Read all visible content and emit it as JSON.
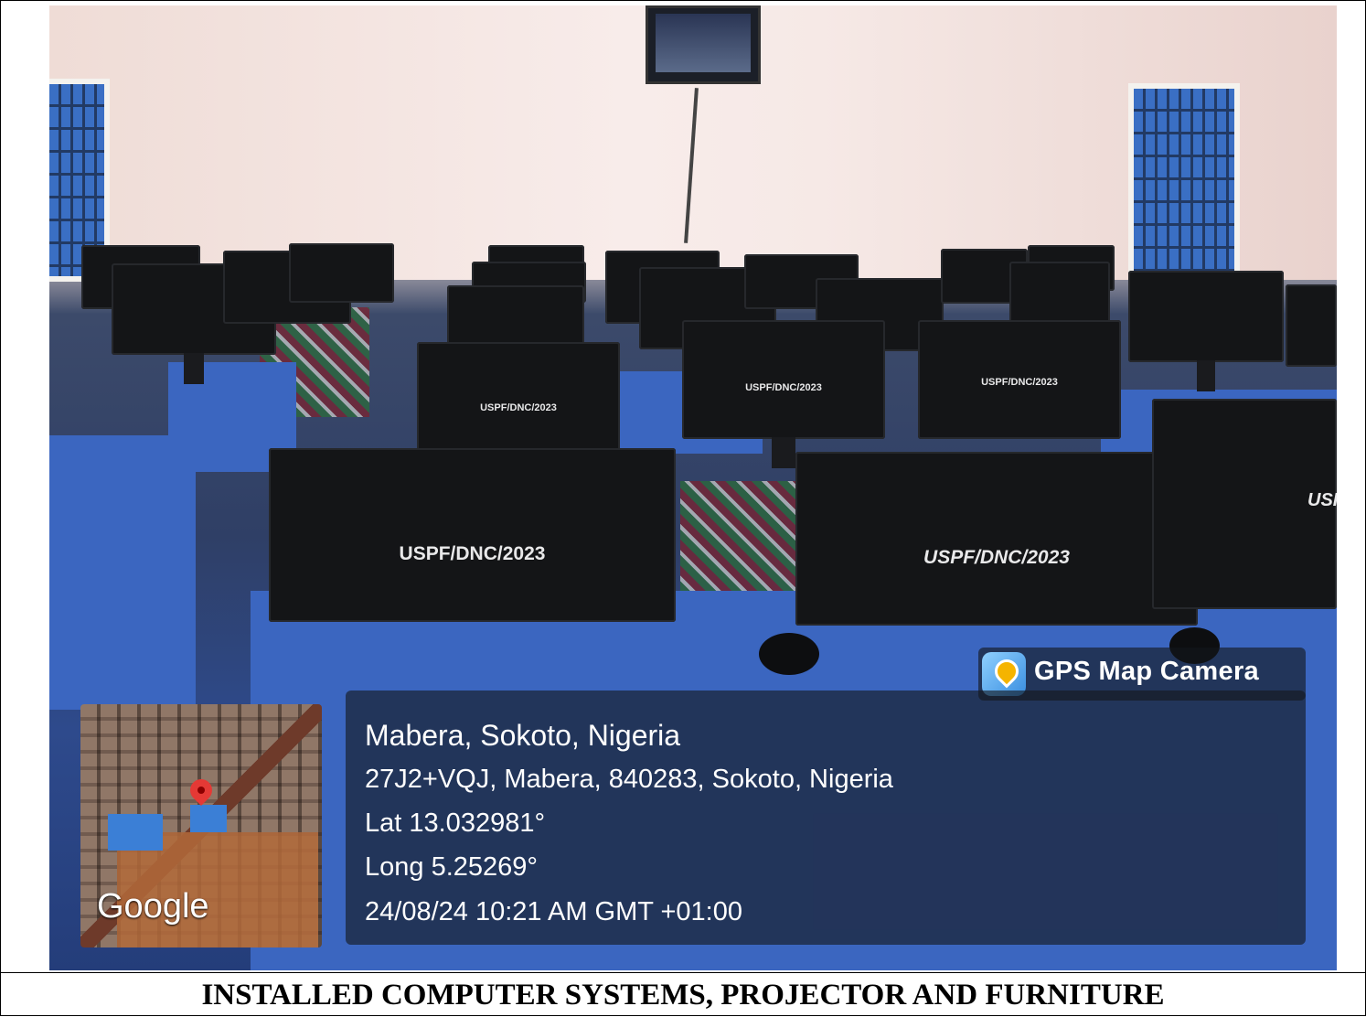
{
  "photo": {
    "monitor_labels": [
      "USPF/DNC/2023",
      "USPF/DNC/2023",
      "USPF/DNC/2023",
      "USPF/DNC/2023",
      "USPF/DNC/2023"
    ],
    "partial_label": "USPF"
  },
  "gps_overlay": {
    "app_name": "GPS Map Camera",
    "location_title": "Mabera, Sokoto, Nigeria",
    "address": "27J2+VQJ, Mabera, 840283, Sokoto, Nigeria",
    "latitude": "Lat 13.032981°",
    "longitude": "Long 5.25269°",
    "timestamp": "24/08/24 10:21 AM GMT +01:00",
    "map_brand": "Google"
  },
  "caption": "INSTALLED COMPUTER SYSTEMS, PROJECTOR AND FURNITURE",
  "colors": {
    "overlay": "#14161c",
    "desk_blue": "#3b66c0",
    "marker_red": "#e53935"
  }
}
